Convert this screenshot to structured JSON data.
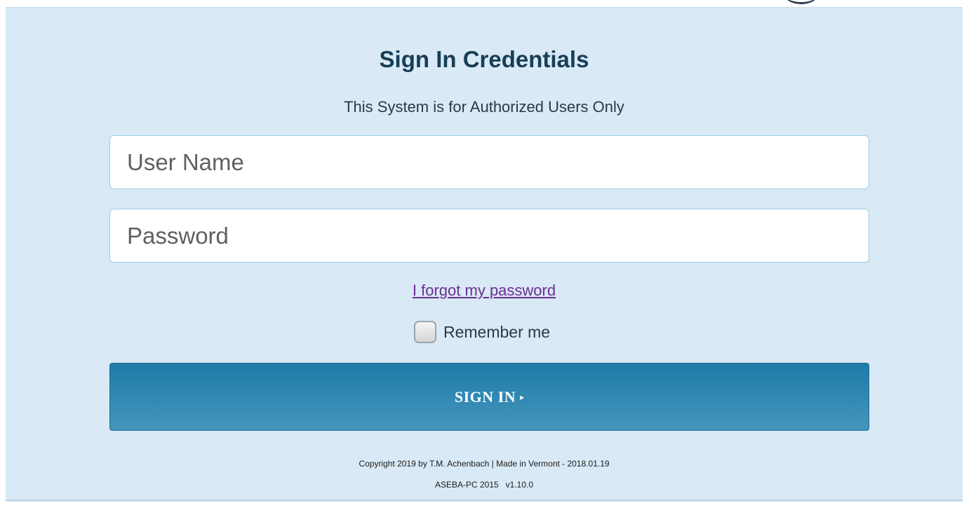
{
  "login": {
    "title": "Sign In Credentials",
    "subtitle": "This System is for Authorized Users Only",
    "username_placeholder": "User Name",
    "password_placeholder": "Password",
    "forgot_link": "I forgot my password",
    "remember_label": "Remember me",
    "signin_label": "SIGN IN",
    "signin_arrow": "▸"
  },
  "footer": {
    "copyright": "Copyright 2019 by T.M. Achenbach | Made in Vermont - 2018.01.19",
    "version": "ASEBA-PC 2015   v1.10.0"
  },
  "colors": {
    "panel_background": "#d9e9f5",
    "title": "#173e57",
    "button_top": "#1e7ba8",
    "button_bottom": "#4496bd",
    "link": "#6b2f93"
  }
}
